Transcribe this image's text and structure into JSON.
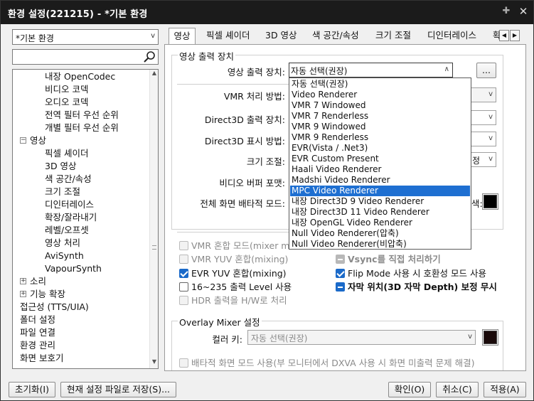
{
  "window": {
    "title": "환경 설정(221215) - *기본 환경"
  },
  "left": {
    "profile": "*기본 환경",
    "search_value": "",
    "tree": [
      {
        "label": "내장 OpenCodec"
      },
      {
        "label": "비디오 코덱"
      },
      {
        "label": "오디오 코덱"
      },
      {
        "label": "전역 필터 우선 순위"
      },
      {
        "label": "개별 필터 우선 순위"
      },
      {
        "label": "영상",
        "expander": "minus"
      },
      {
        "label": "픽셀 셰이더"
      },
      {
        "label": "3D 영상"
      },
      {
        "label": "색 공간/속성"
      },
      {
        "label": "크기 조절"
      },
      {
        "label": "디인터레이스"
      },
      {
        "label": "확장/잘라내기"
      },
      {
        "label": "레벨/오프셋"
      },
      {
        "label": "영상 처리"
      },
      {
        "label": "AviSynth"
      },
      {
        "label": "VapourSynth"
      },
      {
        "label": "소리",
        "expander": "plus"
      },
      {
        "label": "기능 확장",
        "expander": "plus"
      },
      {
        "label": "접근성 (TTS/UIA)"
      },
      {
        "label": "폴더 설정"
      },
      {
        "label": "파일 연결"
      },
      {
        "label": "환경 관리"
      },
      {
        "label": "화면 보호기"
      }
    ]
  },
  "tabs": [
    {
      "label": "영상"
    },
    {
      "label": "픽셀 셰이더"
    },
    {
      "label": "3D 영상"
    },
    {
      "label": "색 공간/속성"
    },
    {
      "label": "크기 조절"
    },
    {
      "label": "디인터레이스"
    },
    {
      "label": "확"
    }
  ],
  "output": {
    "group_label": "영상 출력 장치",
    "device_label": "영상 출력 장치:",
    "device_value": "자동 선택(권장)",
    "more_button": "...",
    "vmr_label": "VMR 처리 방법:",
    "d3d_out_label": "Direct3D 출력 장치:",
    "d3d_disp_label": "Direct3D 표시 방법:",
    "resize_label": "크기 조절:",
    "resize_value_tail": "정",
    "buffer_label": "비디오 버퍼 포맷:",
    "fullscreen_label": "전체 화면 배타적 모드:",
    "color_tail": "색:",
    "swatch_color": "#000000"
  },
  "dropdown": {
    "items": [
      "자동 선택(권장)",
      "Video Renderer",
      "VMR 7 Windowed",
      "VMR 7 Renderless",
      "VMR 9 Windowed",
      "VMR 9 Renderless",
      "EVR(Vista / .Net3)",
      "EVR Custom Present",
      "Haali Video Renderer",
      "Madshi Video Renderer",
      "MPC Video Renderer",
      "내장 Direct3D 9 Video Renderer",
      "내장 Direct3D 11 Video Renderer",
      "내장 OpenGL Video Renderer",
      "Null Video Renderer(압축)",
      "Null Video Renderer(비압축)"
    ],
    "selected_index": 10
  },
  "options": {
    "vmr_mix": "VMR 혼합 모드(mixer mo",
    "vmr_yuv": "VMR YUV 혼합(mixing)",
    "evr_yuv": "EVR YUV 혼합(mixing)",
    "range": "16~235 출력 Level 사용",
    "hdr": "HDR 출력을 H/W로 처리",
    "vsync": "Vsync를 직접 처리하기",
    "flip": "Flip Mode 사용 시 호환성 모드 사용",
    "subtitle": "자막 위치(3D 자막 Depth) 보정 무시"
  },
  "overlay": {
    "group_label": "Overlay Mixer 설정",
    "color_key_label": "컬러 키:",
    "color_key_value": "자동 선택(권장)",
    "exclusive": "배타적 화면 모드 사용(부 모니터에서 DXVA 사용 시 화면 미출력 문제 해결)"
  },
  "buttons": {
    "reset": "초기화(I)",
    "save": "현재 설정 파일로 저장(S)...",
    "ok": "확인(O)",
    "cancel": "취소(C)",
    "apply": "적용(A)"
  }
}
